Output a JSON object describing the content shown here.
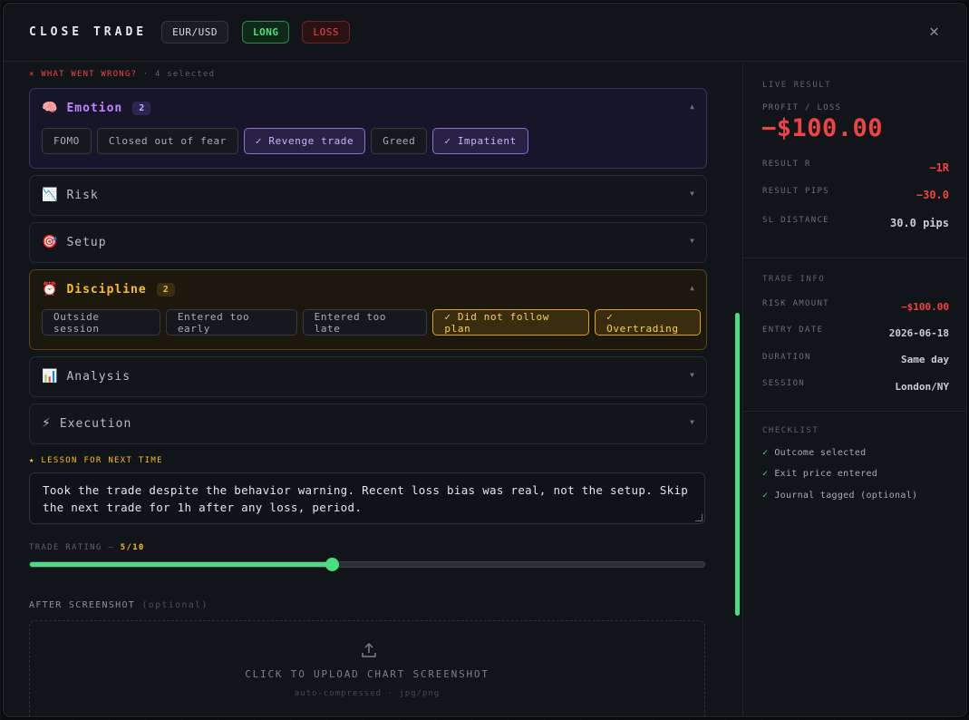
{
  "header": {
    "title": "CLOSE TRADE",
    "pair": "EUR/USD",
    "direction": "LONG",
    "outcome": "LOSS",
    "close_icon": "close-icon"
  },
  "wrong": {
    "label": "× WHAT WENT WRONG?",
    "count": "· 4 selected"
  },
  "categories": [
    {
      "name": "Emotion",
      "icon": "brain-icon",
      "glyph": "🧠",
      "badge": "2",
      "expanded": true,
      "tags": [
        {
          "label": "FOMO",
          "selected": false
        },
        {
          "label": "Closed out of fear",
          "selected": false
        },
        {
          "label": "✓ Revenge trade",
          "selected": true
        },
        {
          "label": "Greed",
          "selected": false
        },
        {
          "label": "✓ Impatient",
          "selected": true
        }
      ]
    },
    {
      "name": "Risk",
      "icon": "chart-down-icon",
      "glyph": "📉",
      "expanded": false
    },
    {
      "name": "Setup",
      "icon": "target-icon",
      "glyph": "🎯",
      "expanded": false
    },
    {
      "name": "Discipline",
      "icon": "alarm-clock-icon",
      "glyph": "⏰",
      "badge": "2",
      "expanded": true,
      "tags": [
        {
          "label": "Outside session",
          "selected": false
        },
        {
          "label": "Entered too early",
          "selected": false
        },
        {
          "label": "Entered too late",
          "selected": false
        },
        {
          "label": "✓ Did not follow plan",
          "selected": true
        },
        {
          "label": "✓ Overtrading",
          "selected": true
        }
      ]
    },
    {
      "name": "Analysis",
      "icon": "bar-chart-icon",
      "glyph": "📊",
      "expanded": false
    },
    {
      "name": "Execution",
      "icon": "lightning-icon",
      "glyph": "⚡",
      "expanded": false
    }
  ],
  "lesson": {
    "label": "★ LESSON FOR NEXT TIME",
    "text": "Took the trade despite the behavior warning. Recent loss bias was real, not the setup. Skip the next trade for 1h after any loss, period."
  },
  "rating": {
    "label": "TRADE RATING —",
    "value_text": "5/10",
    "value": 5,
    "max": 10
  },
  "screenshot": {
    "label": "AFTER SCREENSHOT",
    "optional": "(optional)",
    "cta": "CLICK TO UPLOAD CHART SCREENSHOT",
    "sub": "auto-compressed · jpg/png"
  },
  "live_result": {
    "title": "LIVE RESULT",
    "pnl_label": "PROFIT / LOSS",
    "pnl": "−$100.00",
    "rows": [
      {
        "k": "RESULT R",
        "v": "−1R"
      },
      {
        "k": "RESULT PIPS",
        "v": "−30.0"
      },
      {
        "k": "SL DISTANCE",
        "v": "30.0 pips"
      }
    ]
  },
  "trade_info": {
    "title": "TRADE INFO",
    "rows": [
      {
        "k": "RISK AMOUNT",
        "v": "−$100.00"
      },
      {
        "k": "ENTRY DATE",
        "v": "2026-06-18"
      },
      {
        "k": "DURATION",
        "v": "Same day"
      },
      {
        "k": "SESSION",
        "v": "London/NY"
      }
    ]
  },
  "checklist": {
    "title": "CHECKLIST",
    "items": [
      "Outcome selected",
      "Exit price entered",
      "Journal tagged (optional)"
    ]
  },
  "colors": {
    "accent": "#4ade80",
    "loss": "#ef4444",
    "emotion": "#c084fc",
    "discipline": "#fbbf24"
  }
}
